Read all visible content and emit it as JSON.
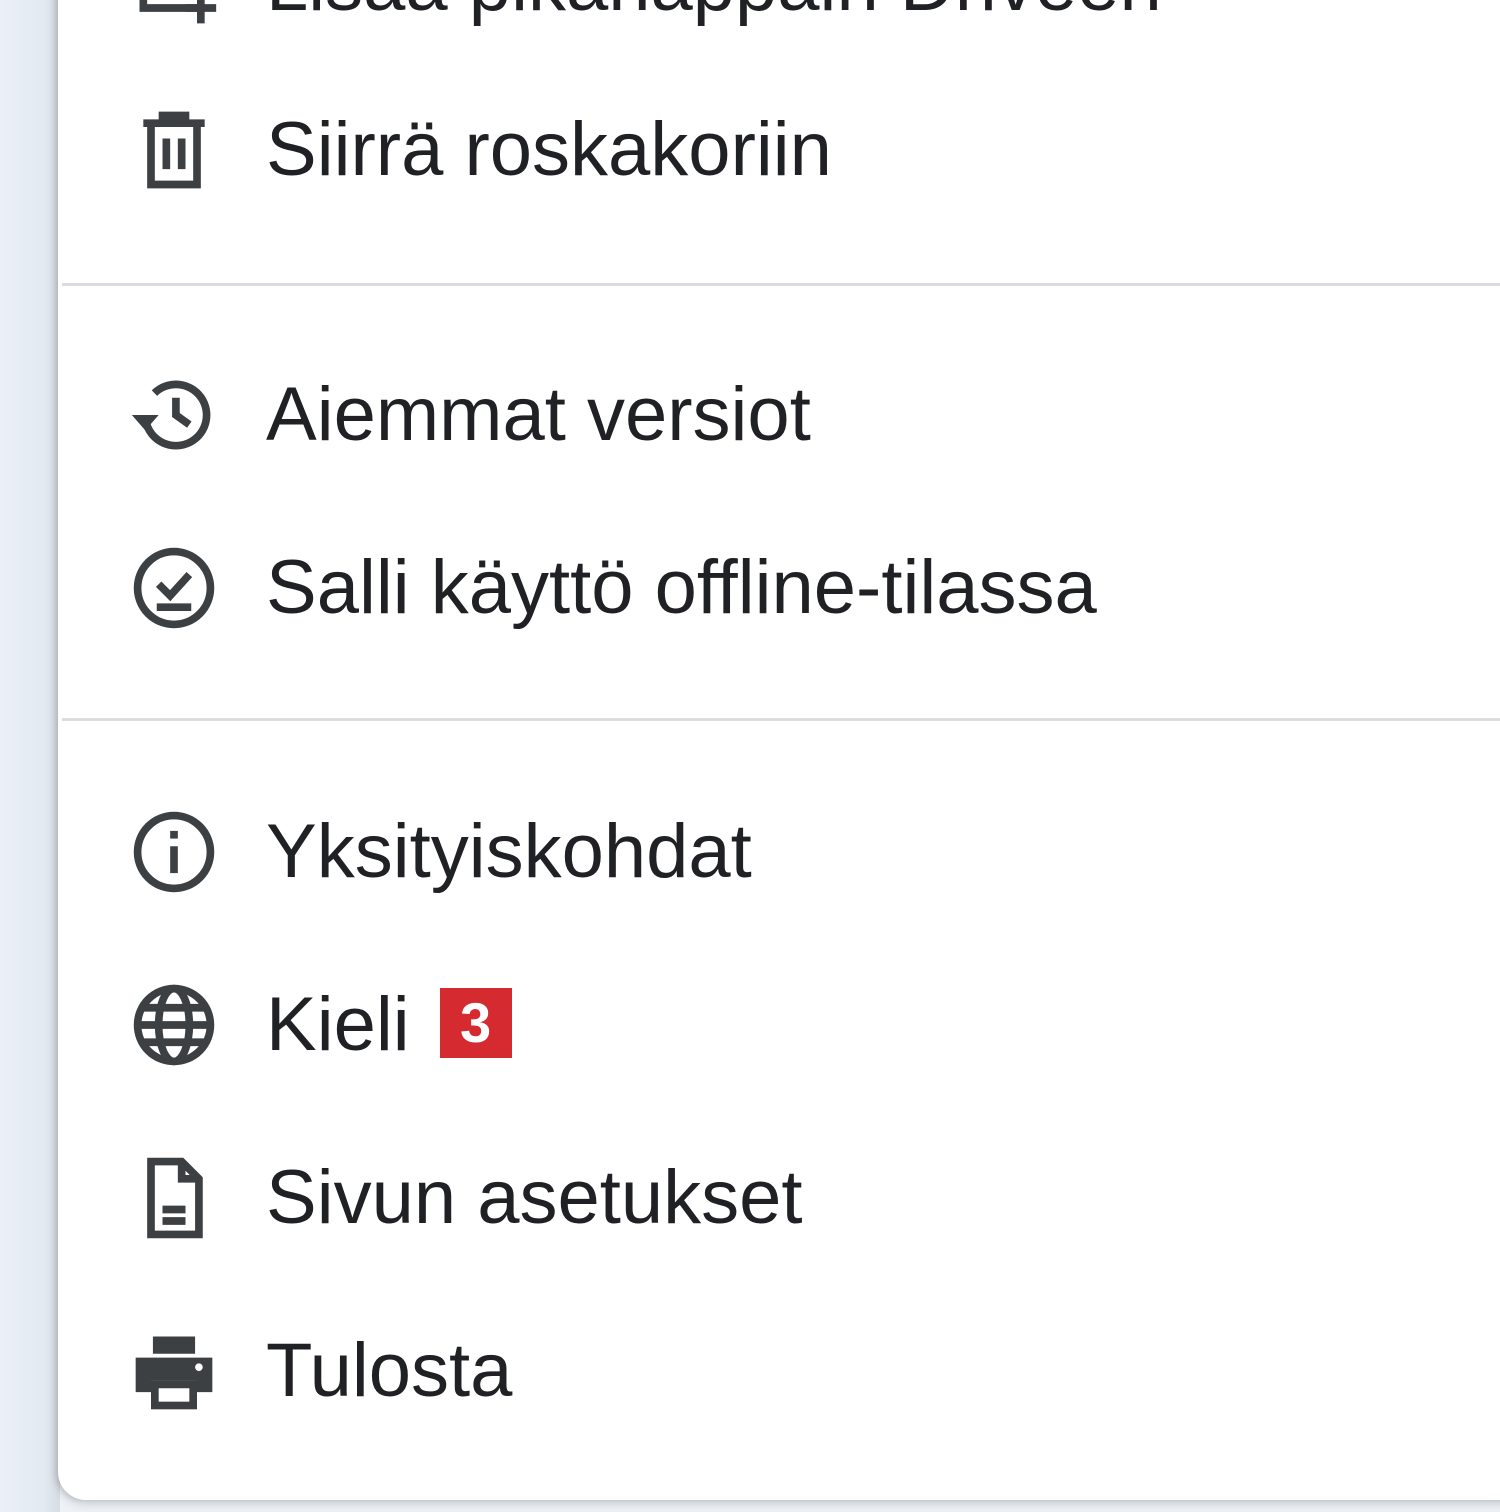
{
  "menu": {
    "top_item": {
      "label": "Lisää pikanäppäin Driveen",
      "icon": "drive-add-shortcut-icon"
    },
    "trash_item": {
      "label": "Siirrä roskakoriin",
      "icon": "trash-icon"
    },
    "history_item": {
      "label": "Aiemmat versiot",
      "icon": "history-icon"
    },
    "offline_item": {
      "label": "Salli käyttö offline-tilassa",
      "icon": "offline-check-icon"
    },
    "details_item": {
      "label": "Yksityiskohdat",
      "icon": "info-icon"
    },
    "language_item": {
      "label": "Kieli",
      "badge": "3",
      "icon": "globe-icon",
      "badge_color": "#d42a30"
    },
    "page_setup_item": {
      "label": "Sivun asetukset",
      "icon": "document-icon"
    },
    "print_item": {
      "label": "Tulosta",
      "icon": "print-icon"
    }
  },
  "colors": {
    "text": "#202124",
    "divider": "#dadce0",
    "background": "#ffffff"
  }
}
